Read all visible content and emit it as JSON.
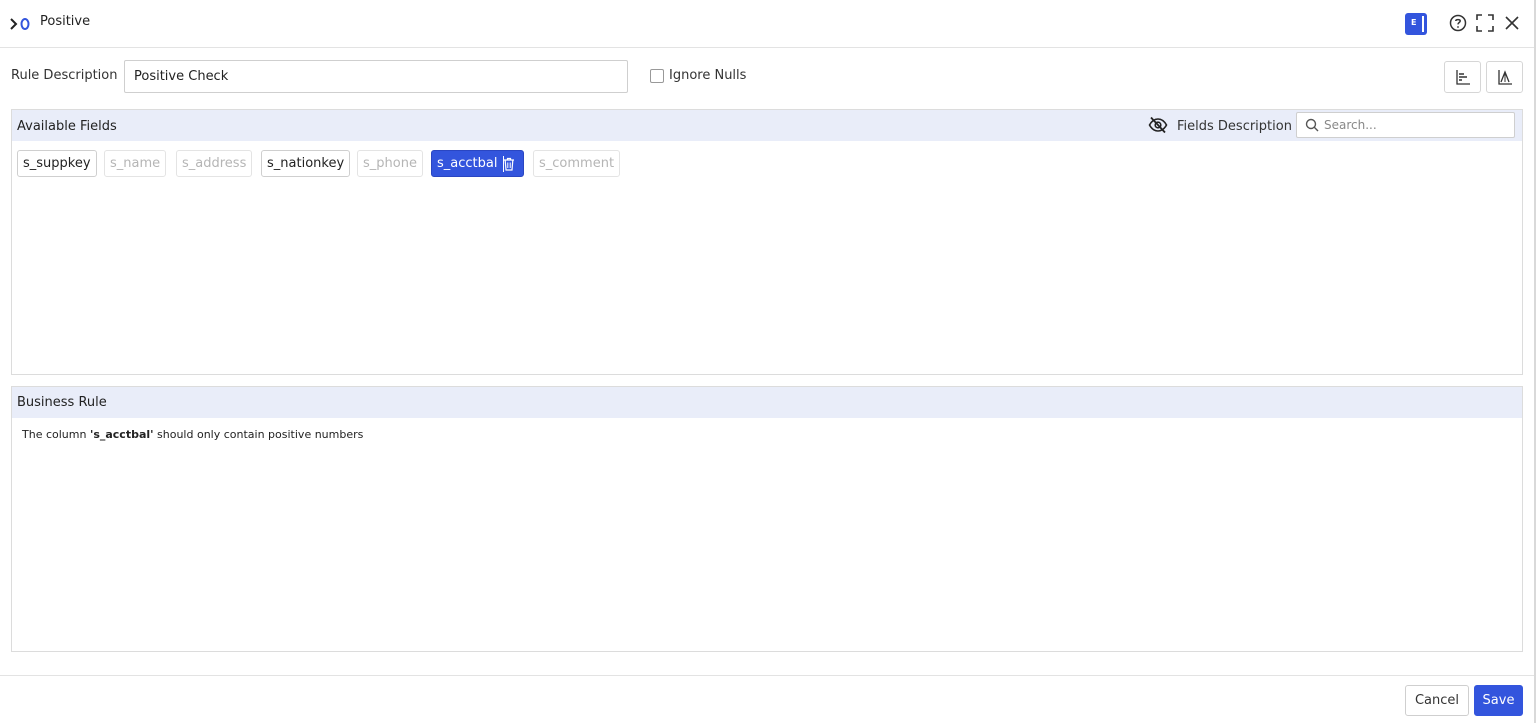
{
  "header": {
    "title": "Positive",
    "badge_letter": "E",
    "icons": [
      "rule-logo-icon",
      "help-icon",
      "fullscreen-icon",
      "close-icon"
    ]
  },
  "rule": {
    "description_label": "Rule Description",
    "description_value": "Positive Check",
    "ignore_nulls_label": "Ignore Nulls",
    "ignore_nulls_checked": false,
    "tool_icons": [
      "bar-chart-icon",
      "distribution-chart-icon"
    ]
  },
  "available_fields": {
    "title": "Available Fields",
    "fields_description_label": "Fields Description",
    "search_placeholder": "Search...",
    "fields": [
      {
        "name": "s_suppkey",
        "state": "enabled"
      },
      {
        "name": "s_name",
        "state": "disabled"
      },
      {
        "name": "s_address",
        "state": "disabled"
      },
      {
        "name": "s_nationkey",
        "state": "enabled"
      },
      {
        "name": "s_phone",
        "state": "disabled"
      },
      {
        "name": "s_acctbal",
        "state": "selected"
      },
      {
        "name": "s_comment",
        "state": "disabled"
      }
    ]
  },
  "business_rule": {
    "title": "Business Rule",
    "text_prefix": "The column ",
    "column_name": "'s_acctbal'",
    "text_suffix": " should only contain positive numbers"
  },
  "footer": {
    "cancel_label": "Cancel",
    "save_label": "Save"
  },
  "colors": {
    "accent": "#3355dd",
    "panel_header_bg": "#e9edf9"
  }
}
